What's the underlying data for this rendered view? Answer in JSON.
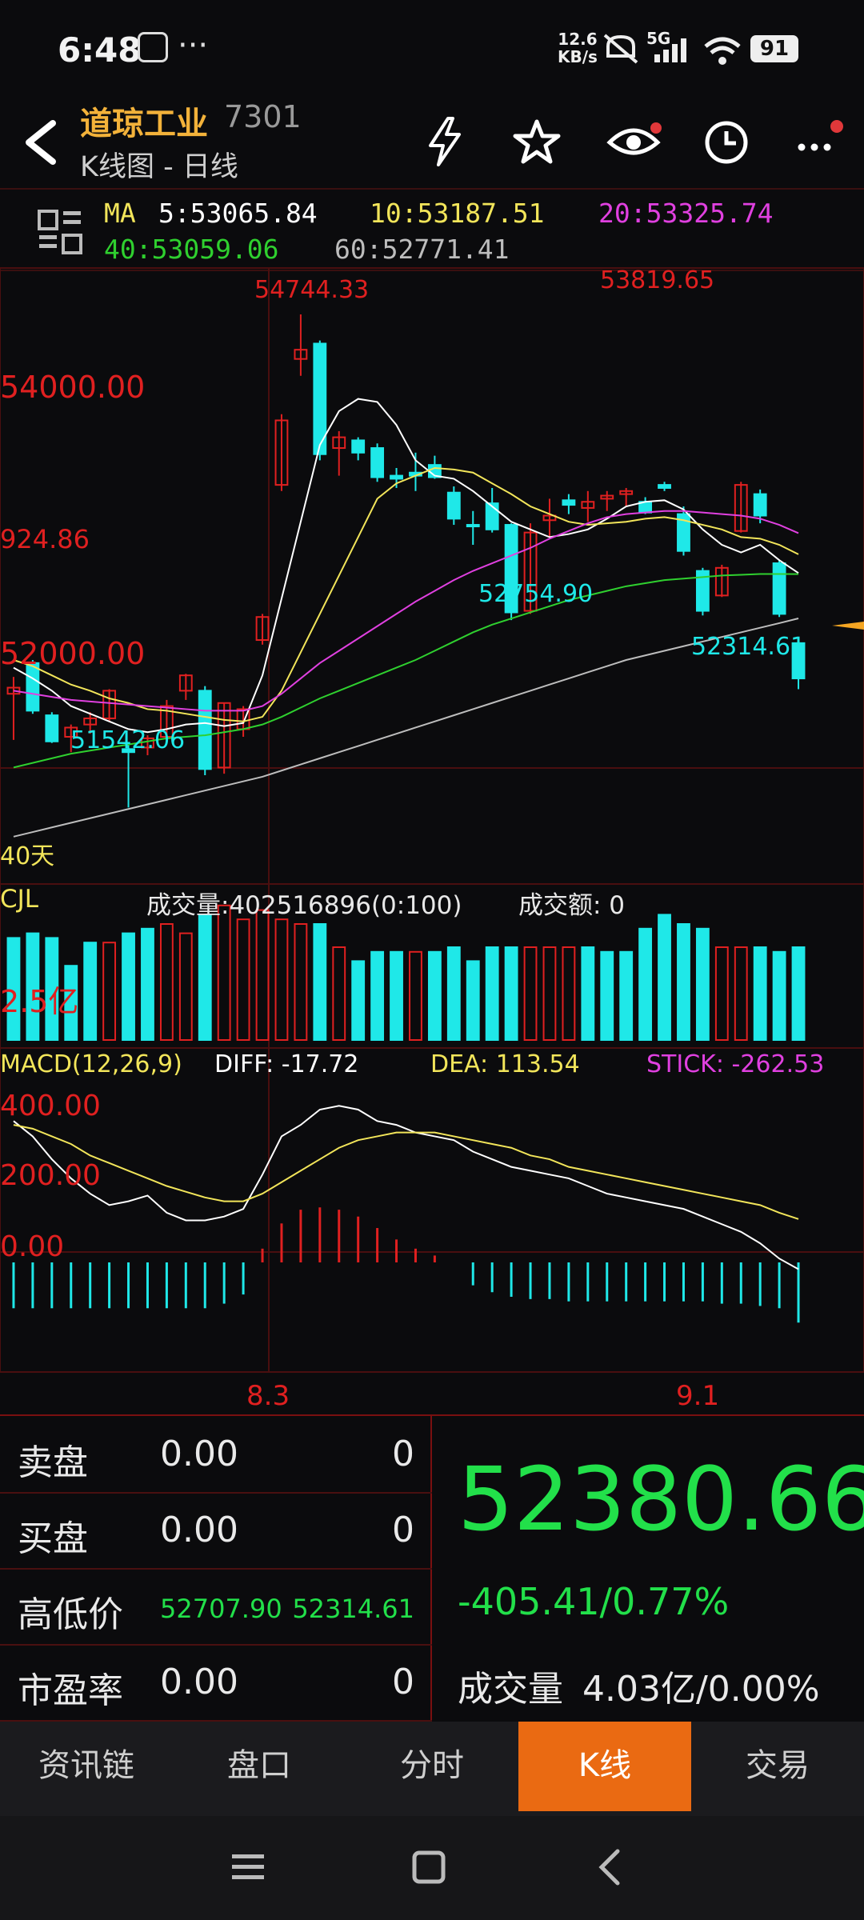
{
  "status_bar": {
    "time": "6:48",
    "net_speed_top": "12.6",
    "net_speed_unit": "KB/s",
    "signal": "5G",
    "battery": "91"
  },
  "header": {
    "title": "道琼工业",
    "code": "7301",
    "subtitle": "K线图 - 日线"
  },
  "ma": {
    "label": "MA",
    "ma5": "5:53065.84",
    "ma10": "10:53187.51",
    "ma20": "20:53325.74",
    "ma40": "40:53059.06",
    "ma60": "60:52771.41"
  },
  "price_chart": {
    "ylabels": [
      "54000.00",
      "924.86",
      "52000.00"
    ],
    "annotations": [
      "54744.33",
      "53819.65",
      "52754.90",
      "52314.61",
      "51542.06"
    ],
    "period": "40天"
  },
  "volume": {
    "label": "CJL",
    "volume_text": "成交量:402516896(0:100)",
    "amount_text": "成交额: 0",
    "scale_label": "2.5亿"
  },
  "macd": {
    "label": "MACD(12,26,9)",
    "diff": "DIFF: -17.72",
    "dea": "DEA: 113.54",
    "stick": "STICK: -262.53",
    "ylabels": [
      "400.00",
      "200.00",
      "0.00"
    ]
  },
  "dates": [
    "8.3",
    "9.1"
  ],
  "order_book": {
    "rows": [
      {
        "label": "卖盘",
        "v1": "0.00",
        "v2": "0"
      },
      {
        "label": "买盘",
        "v1": "0.00",
        "v2": "0"
      },
      {
        "label": "高低价",
        "v1": "52707.90",
        "v2": "52314.61"
      },
      {
        "label": "市盈率",
        "v1": "0.00",
        "v2": "0"
      }
    ],
    "price": "52380.66",
    "change": "-405.41/0.77%",
    "volume_label": "成交量",
    "volume_value": "4.03亿/0.00%"
  },
  "tabs": [
    "资讯链",
    "盘口",
    "分时",
    "K线",
    "交易"
  ],
  "active_tab": "K线",
  "colors": {
    "up": "#e02020",
    "down": "#1fe8e8",
    "ma5": "#ffffff",
    "ma10": "#f2e55a",
    "ma20": "#e040e0",
    "ma40": "#2fd02f",
    "ma60": "#bdbdbd",
    "accent": "#ea6a12",
    "price_green": "#22e04a"
  },
  "chart_data": [
    {
      "type": "candlestick",
      "title": "道琼工业 K线图 - 日线",
      "x_ticks": [
        "8.3",
        "9.1"
      ],
      "ylim": [
        51250,
        55000
      ],
      "candles": [
        {
          "o": 52280,
          "h": 52390,
          "l": 51980,
          "c": 52320
        },
        {
          "o": 52480,
          "h": 52500,
          "l": 52150,
          "c": 52170
        },
        {
          "o": 52140,
          "h": 52160,
          "l": 51960,
          "c": 51970
        },
        {
          "o": 52000,
          "h": 52080,
          "l": 51900,
          "c": 52060
        },
        {
          "o": 52080,
          "h": 52160,
          "l": 52020,
          "c": 52120
        },
        {
          "o": 52120,
          "h": 52310,
          "l": 52100,
          "c": 52300
        },
        {
          "o": 51920,
          "h": 51950,
          "l": 51540,
          "c": 51900
        },
        {
          "o": 51930,
          "h": 52010,
          "l": 51880,
          "c": 51990
        },
        {
          "o": 52000,
          "h": 52240,
          "l": 51980,
          "c": 52200
        },
        {
          "o": 52300,
          "h": 52410,
          "l": 52240,
          "c": 52400
        },
        {
          "o": 52300,
          "h": 52330,
          "l": 51750,
          "c": 51790
        },
        {
          "o": 51800,
          "h": 52220,
          "l": 51760,
          "c": 52220
        },
        {
          "o": 52050,
          "h": 52200,
          "l": 52000,
          "c": 52180
        },
        {
          "o": 52630,
          "h": 52800,
          "l": 52600,
          "c": 52780
        },
        {
          "o": 53640,
          "h": 54100,
          "l": 53600,
          "c": 54060
        },
        {
          "o": 54460,
          "h": 54750,
          "l": 54350,
          "c": 54520
        },
        {
          "o": 54560,
          "h": 54580,
          "l": 53800,
          "c": 53840
        },
        {
          "o": 53880,
          "h": 53990,
          "l": 53700,
          "c": 53950
        },
        {
          "o": 53930,
          "h": 53950,
          "l": 53800,
          "c": 53850
        },
        {
          "o": 53880,
          "h": 53910,
          "l": 53660,
          "c": 53690
        },
        {
          "o": 53700,
          "h": 53750,
          "l": 53620,
          "c": 53680
        },
        {
          "o": 53720,
          "h": 53850,
          "l": 53600,
          "c": 53700
        },
        {
          "o": 53770,
          "h": 53830,
          "l": 53680,
          "c": 53690
        },
        {
          "o": 53590,
          "h": 53630,
          "l": 53380,
          "c": 53420
        },
        {
          "o": 53380,
          "h": 53470,
          "l": 53250,
          "c": 53370
        },
        {
          "o": 53520,
          "h": 53620,
          "l": 53330,
          "c": 53350
        },
        {
          "o": 53380,
          "h": 53390,
          "l": 52760,
          "c": 52810
        },
        {
          "o": 52820,
          "h": 53390,
          "l": 52800,
          "c": 53330
        },
        {
          "o": 53410,
          "h": 53550,
          "l": 53300,
          "c": 53440
        },
        {
          "o": 53540,
          "h": 53580,
          "l": 53450,
          "c": 53510
        },
        {
          "o": 53490,
          "h": 53600,
          "l": 53400,
          "c": 53530
        },
        {
          "o": 53550,
          "h": 53600,
          "l": 53470,
          "c": 53570
        },
        {
          "o": 53580,
          "h": 53620,
          "l": 53500,
          "c": 53600
        },
        {
          "o": 53530,
          "h": 53560,
          "l": 53450,
          "c": 53460
        },
        {
          "o": 53640,
          "h": 53660,
          "l": 53600,
          "c": 53620
        },
        {
          "o": 53450,
          "h": 53500,
          "l": 53180,
          "c": 53210
        },
        {
          "o": 53080,
          "h": 53100,
          "l": 52790,
          "c": 52820
        },
        {
          "o": 52920,
          "h": 53120,
          "l": 52910,
          "c": 53100
        },
        {
          "o": 53340,
          "h": 53660,
          "l": 53330,
          "c": 53640
        },
        {
          "o": 53580,
          "h": 53610,
          "l": 53390,
          "c": 53440
        },
        {
          "o": 53130,
          "h": 53150,
          "l": 52780,
          "c": 52800
        },
        {
          "o": 52610,
          "h": 52630,
          "l": 52310,
          "c": 52380
        }
      ],
      "ma_series": [
        {
          "name": "MA5",
          "values": [
            52450,
            52380,
            52300,
            52200,
            52150,
            52100,
            52050,
            52030,
            52050,
            52080,
            52090,
            52070,
            52090,
            52400,
            52900,
            53400,
            53900,
            54120,
            54200,
            54180,
            54030,
            53800,
            53700,
            53680,
            53600,
            53500,
            53400,
            53350,
            53300,
            53320,
            53350,
            53420,
            53500,
            53530,
            53540,
            53480,
            53350,
            53250,
            53200,
            53250,
            53150,
            53066
          ]
        },
        {
          "name": "MA10",
          "values": [
            52500,
            52460,
            52400,
            52340,
            52300,
            52250,
            52220,
            52180,
            52170,
            52150,
            52130,
            52110,
            52100,
            52130,
            52300,
            52550,
            52800,
            53050,
            53300,
            53550,
            53650,
            53700,
            53750,
            53740,
            53720,
            53650,
            53580,
            53500,
            53450,
            53400,
            53380,
            53390,
            53400,
            53420,
            53430,
            53410,
            53380,
            53350,
            53300,
            53290,
            53250,
            53188
          ]
        },
        {
          "name": "MA20",
          "values": [
            52300,
            52280,
            52260,
            52240,
            52230,
            52220,
            52210,
            52200,
            52190,
            52180,
            52170,
            52170,
            52170,
            52200,
            52280,
            52380,
            52480,
            52560,
            52640,
            52720,
            52800,
            52880,
            52950,
            53020,
            53080,
            53130,
            53180,
            53230,
            53290,
            53340,
            53390,
            53430,
            53450,
            53460,
            53470,
            53470,
            53460,
            53450,
            53440,
            53420,
            53380,
            53326
          ]
        },
        {
          "name": "MA40",
          "values": [
            51800,
            51830,
            51860,
            51890,
            51910,
            51930,
            51950,
            51970,
            51990,
            52000,
            52010,
            52030,
            52050,
            52080,
            52130,
            52190,
            52250,
            52300,
            52350,
            52400,
            52450,
            52500,
            52560,
            52620,
            52680,
            52730,
            52770,
            52810,
            52850,
            52890,
            52920,
            52950,
            52980,
            53000,
            53020,
            53030,
            53040,
            53050,
            53055,
            53060,
            53060,
            53059
          ]
        },
        {
          "name": "MA60",
          "values": [
            51350,
            51380,
            51410,
            51440,
            51470,
            51500,
            51530,
            51560,
            51590,
            51620,
            51650,
            51680,
            51710,
            51740,
            51780,
            51820,
            51860,
            51900,
            51940,
            51980,
            52020,
            52060,
            52100,
            52140,
            52180,
            52220,
            52260,
            52300,
            52340,
            52380,
            52420,
            52460,
            52500,
            52530,
            52560,
            52590,
            52620,
            52650,
            52680,
            52710,
            52740,
            52771
          ]
        }
      ]
    },
    {
      "type": "bar",
      "title": "CJL",
      "values_yi": [
        2.2,
        2.3,
        2.2,
        1.6,
        2.1,
        2.1,
        2.3,
        2.4,
        2.5,
        2.3,
        2.7,
        2.9,
        2.6,
        2.8,
        2.6,
        2.5,
        2.5,
        2.0,
        1.7,
        1.9,
        1.9,
        1.9,
        1.9,
        2.0,
        1.7,
        2.0,
        2.0,
        2.0,
        2.0,
        2.0,
        2.0,
        1.9,
        1.9,
        2.4,
        2.7,
        2.5,
        2.4,
        2.0,
        2.0,
        2.0,
        1.9,
        2.0
      ],
      "up": [
        false,
        false,
        false,
        false,
        false,
        true,
        false,
        false,
        true,
        true,
        false,
        true,
        true,
        true,
        true,
        true,
        false,
        true,
        false,
        false,
        false,
        true,
        false,
        false,
        false,
        false,
        false,
        true,
        true,
        true,
        false,
        false,
        false,
        false,
        false,
        false,
        false,
        true,
        true,
        false,
        false,
        false
      ]
    },
    {
      "type": "line",
      "title": "MACD(12,26,9)",
      "series": [
        {
          "name": "DIFF",
          "values": [
            370,
            330,
            270,
            220,
            180,
            150,
            160,
            175,
            130,
            110,
            110,
            120,
            140,
            230,
            330,
            360,
            400,
            410,
            400,
            370,
            360,
            340,
            330,
            320,
            290,
            270,
            250,
            240,
            230,
            220,
            200,
            180,
            170,
            160,
            150,
            140,
            120,
            100,
            80,
            50,
            10,
            -17.72
          ]
        },
        {
          "name": "DEA",
          "values": [
            360,
            350,
            330,
            310,
            280,
            260,
            240,
            220,
            200,
            185,
            170,
            160,
            160,
            180,
            210,
            240,
            270,
            300,
            320,
            330,
            340,
            340,
            340,
            330,
            320,
            310,
            300,
            280,
            270,
            250,
            240,
            230,
            220,
            210,
            200,
            190,
            180,
            170,
            160,
            150,
            130,
            113.54
          ]
        }
      ],
      "stick": [
        -200,
        -200,
        -200,
        -200,
        -200,
        -200,
        -200,
        -200,
        -200,
        -200,
        -200,
        -180,
        -140,
        60,
        170,
        230,
        240,
        230,
        200,
        150,
        100,
        60,
        30,
        0,
        -100,
        -130,
        -150,
        -160,
        -160,
        -170,
        -170,
        -170,
        -170,
        -170,
        -170,
        -170,
        -170,
        -180,
        -180,
        -190,
        -200,
        -262.53
      ],
      "ylim": [
        -300,
        500
      ]
    }
  ]
}
